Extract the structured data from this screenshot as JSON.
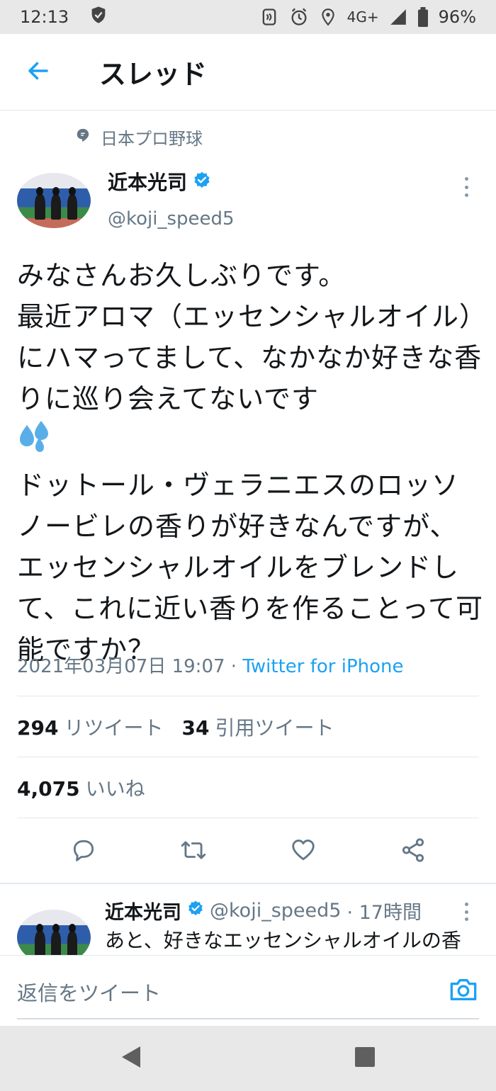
{
  "status_bar": {
    "time": "12:13",
    "network": "4G+",
    "battery": "96%",
    "icons": [
      "shield-icon",
      "nfc-icon",
      "alarm-icon",
      "location-icon",
      "signal-icon",
      "battery-icon"
    ]
  },
  "header": {
    "title": "スレッド",
    "back_icon": "arrow-left-icon"
  },
  "topic": {
    "label": "日本プロ野球",
    "icon": "topic-icon"
  },
  "tweet": {
    "author_name": "近本光司",
    "author_handle": "@koji_speed5",
    "verified": true,
    "text_part1": "みなさんお久しぶりです。\n最近アロマ（エッセンシャルオイル）にハマってまして、なかなか好きな香りに巡り会えてないです",
    "emoji": "sweat-droplets-emoji",
    "text_part2": "ドットール・ヴェラニエスのロッソノービレの香りが好きなんですが、エッセンシャルオイルをブレンドして、これに近い香りを作ることって可能ですか？",
    "timestamp": "2021年03月07日 19:07",
    "separator": " · ",
    "source": "Twitter for iPhone"
  },
  "stats": {
    "retweets_count": "294",
    "retweets_label": "リツイート",
    "quotes_count": "34",
    "quotes_label": "引用ツイート",
    "likes_count": "4,075",
    "likes_label": "いいね"
  },
  "actions": [
    "reply-icon",
    "retweet-icon",
    "like-icon",
    "share-icon"
  ],
  "reply": {
    "author_name": "近本光司",
    "author_handle": "@koji_speed5",
    "time": "· 17時間",
    "text": "あと、好きなエッセンシャルオイルの香"
  },
  "composer": {
    "placeholder": "返信をツイート",
    "camera_icon": "camera-icon"
  },
  "colors": {
    "accent": "#1da1f2",
    "text_primary": "#14171a",
    "text_secondary": "#657786",
    "divider": "#e1e8ed"
  }
}
